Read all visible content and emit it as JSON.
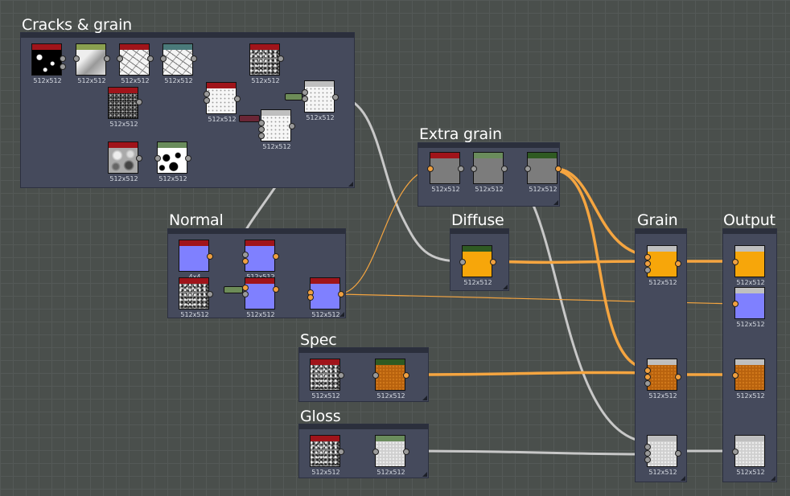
{
  "frames": {
    "cracks": "Cracks & grain",
    "extra": "Extra grain",
    "normal": "Normal",
    "diffuse": "Diffuse",
    "grain": "Grain",
    "output": "Output",
    "spec": "Spec",
    "gloss": "Gloss"
  },
  "labels": {
    "res": "512x512",
    "small": "4x4"
  },
  "colors": {
    "wire_grey": "#c8c8c8",
    "wire_orange": "#f5a540",
    "header_red": "#a0141a",
    "header_green": "#6a8c5c",
    "header_darkgreen": "#2f5a22",
    "header_teal": "#4a7a7a",
    "header_olive": "#8aa050"
  }
}
